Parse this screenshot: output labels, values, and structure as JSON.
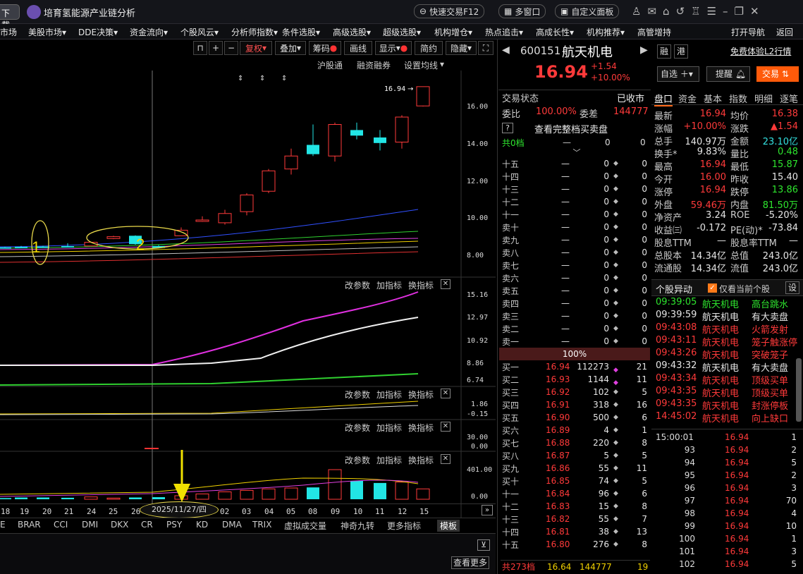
{
  "app": {
    "left_tab": "下载",
    "title": "培育氢能源产业链分析",
    "quick_trade": "快速交易F12",
    "multi_window": "多窗口",
    "custom_panel": "自定义面板"
  },
  "menu": [
    "市场",
    "美股市场",
    "DDE决策",
    "资金流向",
    "个股风云",
    "分析师指数",
    "条件选股",
    "高级选股",
    "超级选股",
    "机构增仓",
    "热点追击",
    "高成长性",
    "机构推荐",
    "高管增持",
    "打开导航",
    "返回"
  ],
  "toolbar": {
    "fuquan": "复权",
    "overlay": "叠加",
    "chips": "筹码",
    "draw": "画线",
    "display": "显示",
    "simple": "简约",
    "hide": "隐藏"
  },
  "chart_header": {
    "hgt": "沪股通",
    "margin": "融资融券",
    "ma_settings": "设置均线"
  },
  "price_axis": [
    "16.00",
    "14.00",
    "12.00",
    "10.00",
    "8.00"
  ],
  "last_price_tag": "16.94",
  "annotations": {
    "mark1": "1",
    "mark2": "2"
  },
  "macd_axis": [
    "15.16",
    "12.97",
    "10.92",
    "8.86",
    "6.74"
  ],
  "sub_controls": {
    "param": "改参数",
    "add": "加指标",
    "switch": "换指标"
  },
  "sub2_axis": [
    "1.86",
    "-0.15"
  ],
  "sub3_axis": [
    "30.00",
    "0.00"
  ],
  "vol_axis": [
    "401.00",
    "0.00"
  ],
  "date_axis": [
    "18",
    "19",
    "20",
    "21",
    "24",
    "25",
    "26",
    "02",
    "03",
    "04",
    "05",
    "08",
    "09",
    "10",
    "11",
    "12",
    "15"
  ],
  "date_highlight": "2025/11/27/四",
  "indicator_tabs": [
    "E",
    "BRAR",
    "CCI",
    "DMI",
    "DKX",
    "CR",
    "PSY",
    "KD",
    "DMA",
    "TRIX",
    "虚拟成交量",
    "神奇九转",
    "更多指标",
    "模板"
  ],
  "bottom": {
    "see_more": "查看更多"
  },
  "stock": {
    "code": "600151",
    "name": "航天机电",
    "price": "16.94",
    "change": "+1.54",
    "change_pct": "+10.00%",
    "tag_rong": "融",
    "tag_gang": "港",
    "l2_link": "免费体验L2行情",
    "zixuan": "自选",
    "remind": "提醒",
    "trade": "交易"
  },
  "trade_status": {
    "label": "交易状态",
    "value": "已收市"
  },
  "weibi": {
    "label1": "委比",
    "val1": "100.00%",
    "label2": "委差",
    "val2": "144777"
  },
  "full_book": "查看完整档买卖盘",
  "book_top": {
    "label": "共0档",
    "dash": "—",
    "v1": "0",
    "v2": "0"
  },
  "asks": [
    {
      "l": "十五",
      "p": "—",
      "v": "0",
      "n": "0"
    },
    {
      "l": "十四",
      "p": "—",
      "v": "0",
      "n": "0"
    },
    {
      "l": "十三",
      "p": "—",
      "v": "0",
      "n": "0"
    },
    {
      "l": "十二",
      "p": "—",
      "v": "0",
      "n": "0"
    },
    {
      "l": "十一",
      "p": "—",
      "v": "0",
      "n": "0"
    },
    {
      "l": "卖十",
      "p": "—",
      "v": "0",
      "n": "0"
    },
    {
      "l": "卖九",
      "p": "—",
      "v": "0",
      "n": "0"
    },
    {
      "l": "卖八",
      "p": "—",
      "v": "0",
      "n": "0"
    },
    {
      "l": "卖七",
      "p": "—",
      "v": "0",
      "n": "0"
    },
    {
      "l": "卖六",
      "p": "—",
      "v": "0",
      "n": "0"
    },
    {
      "l": "卖五",
      "p": "—",
      "v": "0",
      "n": "0"
    },
    {
      "l": "卖四",
      "p": "—",
      "v": "0",
      "n": "0"
    },
    {
      "l": "卖三",
      "p": "—",
      "v": "0",
      "n": "0"
    },
    {
      "l": "卖二",
      "p": "—",
      "v": "0",
      "n": "0"
    },
    {
      "l": "卖一",
      "p": "—",
      "v": "0",
      "n": "0"
    }
  ],
  "book_ratio": "100%",
  "bids": [
    {
      "l": "买一",
      "p": "16.94",
      "v": "112273",
      "n": "21"
    },
    {
      "l": "买二",
      "p": "16.93",
      "v": "1144",
      "n": "11"
    },
    {
      "l": "买三",
      "p": "16.92",
      "v": "102",
      "n": "5"
    },
    {
      "l": "买四",
      "p": "16.91",
      "v": "318",
      "n": "16"
    },
    {
      "l": "买五",
      "p": "16.90",
      "v": "500",
      "n": "6"
    },
    {
      "l": "买六",
      "p": "16.89",
      "v": "4",
      "n": "1"
    },
    {
      "l": "买七",
      "p": "16.88",
      "v": "220",
      "n": "8"
    },
    {
      "l": "买八",
      "p": "16.87",
      "v": "5",
      "n": "5"
    },
    {
      "l": "买九",
      "p": "16.86",
      "v": "55",
      "n": "11"
    },
    {
      "l": "买十",
      "p": "16.85",
      "v": "74",
      "n": "5"
    },
    {
      "l": "十一",
      "p": "16.84",
      "v": "96",
      "n": "6"
    },
    {
      "l": "十二",
      "p": "16.83",
      "v": "15",
      "n": "8"
    },
    {
      "l": "十三",
      "p": "16.82",
      "v": "55",
      "n": "7"
    },
    {
      "l": "十四",
      "p": "16.81",
      "v": "38",
      "n": "13"
    },
    {
      "l": "十五",
      "p": "16.80",
      "v": "276",
      "n": "8"
    }
  ],
  "book_bottom": {
    "label": "共273档",
    "p": "16.64",
    "v": "144777",
    "n": "19"
  },
  "quote_tabs": [
    "盘口",
    "资金",
    "基本",
    "指数",
    "明细",
    "逐笔"
  ],
  "quote": [
    {
      "a": "最新",
      "b": "16.94",
      "c": "均价",
      "d": "16.38"
    },
    {
      "a": "涨幅",
      "b": "+10.00%",
      "c": "涨跌",
      "d": "▲1.54"
    },
    {
      "a": "总手",
      "b": "140.97万",
      "c": "金额",
      "d": "23.10亿"
    },
    {
      "a": "换手*",
      "b": "9.83%",
      "c": "量比",
      "d": "0.48"
    },
    {
      "a": "最高",
      "b": "16.94",
      "c": "最低",
      "d": "15.87"
    },
    {
      "a": "今开",
      "b": "16.00",
      "c": "昨收",
      "d": "15.40"
    },
    {
      "a": "涨停",
      "b": "16.94",
      "c": "跌停",
      "d": "13.86"
    },
    {
      "a": "外盘",
      "b": "59.46万",
      "c": "内盘",
      "d": "81.50万"
    },
    {
      "a": "净资产",
      "b": "3.24",
      "c": "ROE",
      "d": "-5.20%"
    },
    {
      "a": "收益㈢",
      "b": "-0.172",
      "c": "PE(动)*",
      "d": "-73.84"
    },
    {
      "a": "股息TTM",
      "b": "—",
      "c": "股息率TTM",
      "d": "—"
    },
    {
      "a": "总股本",
      "b": "14.34亿",
      "c": "总值",
      "d": "243.0亿"
    },
    {
      "a": "流通股",
      "b": "14.34亿",
      "c": "流值",
      "d": "243.0亿"
    }
  ],
  "events_header": {
    "title": "个股异动",
    "filter": "仅看当前个股",
    "settings": "设"
  },
  "events": [
    {
      "t": "09:39:05",
      "n": "航天机电",
      "e": "高台跳水"
    },
    {
      "t": "09:39:59",
      "n": "航天机电",
      "e": "有大卖盘"
    },
    {
      "t": "09:43:08",
      "n": "航天机电",
      "e": "火箭发射"
    },
    {
      "t": "09:43:11",
      "n": "航天机电",
      "e": "笼子触涨停"
    },
    {
      "t": "09:43:26",
      "n": "航天机电",
      "e": "突破笼子"
    },
    {
      "t": "09:43:32",
      "n": "航天机电",
      "e": "有大卖盘"
    },
    {
      "t": "09:43:34",
      "n": "航天机电",
      "e": "顶级买单"
    },
    {
      "t": "09:43:35",
      "n": "航天机电",
      "e": "顶级买单"
    },
    {
      "t": "09:43:35",
      "n": "航天机电",
      "e": "封涨停板"
    },
    {
      "t": "14:45:02",
      "n": "航天机电",
      "e": "向上缺口"
    }
  ],
  "ticks": [
    {
      "t": "15:00:01",
      "p": "16.94",
      "v": "1"
    },
    {
      "t": "93",
      "p": "16.94",
      "v": "2"
    },
    {
      "t": "94",
      "p": "16.94",
      "v": "5"
    },
    {
      "t": "95",
      "p": "16.94",
      "v": "2"
    },
    {
      "t": "96",
      "p": "16.94",
      "v": "3"
    },
    {
      "t": "97",
      "p": "16.94",
      "v": "70"
    },
    {
      "t": "98",
      "p": "16.94",
      "v": "4"
    },
    {
      "t": "99",
      "p": "16.94",
      "v": "10"
    },
    {
      "t": "100",
      "p": "16.94",
      "v": "1"
    },
    {
      "t": "101",
      "p": "16.94",
      "v": "3"
    },
    {
      "t": "102",
      "p": "16.94",
      "v": "5"
    }
  ],
  "chart_data": {
    "type": "candlestick",
    "candles": [
      {
        "o": 8.25,
        "c": 8.28,
        "h": 8.3,
        "l": 8.22,
        "up": false
      },
      {
        "o": 8.26,
        "c": 8.28,
        "h": 8.32,
        "l": 8.24,
        "up": false
      },
      {
        "o": 8.28,
        "c": 8.3,
        "h": 8.35,
        "l": 8.26,
        "up": false
      },
      {
        "o": 8.3,
        "c": 8.32,
        "h": 8.36,
        "l": 8.28,
        "up": false
      },
      {
        "o": 8.3,
        "c": 8.34,
        "h": 8.5,
        "l": 8.28,
        "up": false
      },
      {
        "o": 8.35,
        "c": 8.55,
        "h": 8.58,
        "l": 8.34,
        "up": true
      },
      {
        "o": 8.75,
        "c": 8.85,
        "h": 8.9,
        "l": 8.72,
        "up": true
      },
      {
        "o": 8.9,
        "c": 8.45,
        "h": 8.92,
        "l": 8.42,
        "up": false
      },
      {
        "o": 8.25,
        "c": 8.35,
        "h": 8.4,
        "l": 8.22,
        "up": false
      },
      {
        "o": 8.9,
        "c": 9.2,
        "h": 9.35,
        "l": 8.95,
        "up": true
      },
      {
        "o": 9.7,
        "c": 9.75,
        "h": 9.95,
        "l": 9.65,
        "up": true
      },
      {
        "o": 9.6,
        "c": 10.1,
        "h": 10.3,
        "l": 9.5,
        "up": true
      },
      {
        "o": 10.2,
        "c": 11.1,
        "h": 11.2,
        "l": 10.0,
        "up": true
      },
      {
        "o": 11.3,
        "c": 12.4,
        "h": 12.5,
        "l": 11.2,
        "up": true
      },
      {
        "o": 12.5,
        "c": 13.2,
        "h": 13.6,
        "l": 12.2,
        "up": true
      },
      {
        "o": 13.8,
        "c": 13.3,
        "h": 14.9,
        "l": 13.2,
        "up": false
      },
      {
        "o": 13.2,
        "c": 14.9,
        "h": 15.0,
        "l": 12.9,
        "up": true
      },
      {
        "o": 14.6,
        "c": 14.3,
        "h": 15.0,
        "l": 14.1,
        "up": false
      },
      {
        "o": 14.2,
        "c": 13.9,
        "h": 14.6,
        "l": 13.5,
        "up": false
      },
      {
        "o": 13.95,
        "c": 15.3,
        "h": 15.4,
        "l": 13.6,
        "up": true
      },
      {
        "o": 15.9,
        "c": 16.94,
        "h": 16.94,
        "l": 15.87,
        "up": true
      }
    ],
    "volumes": [
      0.04,
      0.05,
      0.06,
      0.06,
      0.05,
      0.08,
      0.04,
      0.06,
      0.07,
      0.12,
      0.18,
      0.25,
      0.3,
      0.35,
      0.38,
      0.4,
      1.0,
      0.62,
      0.55,
      0.58,
      0.35
    ]
  }
}
